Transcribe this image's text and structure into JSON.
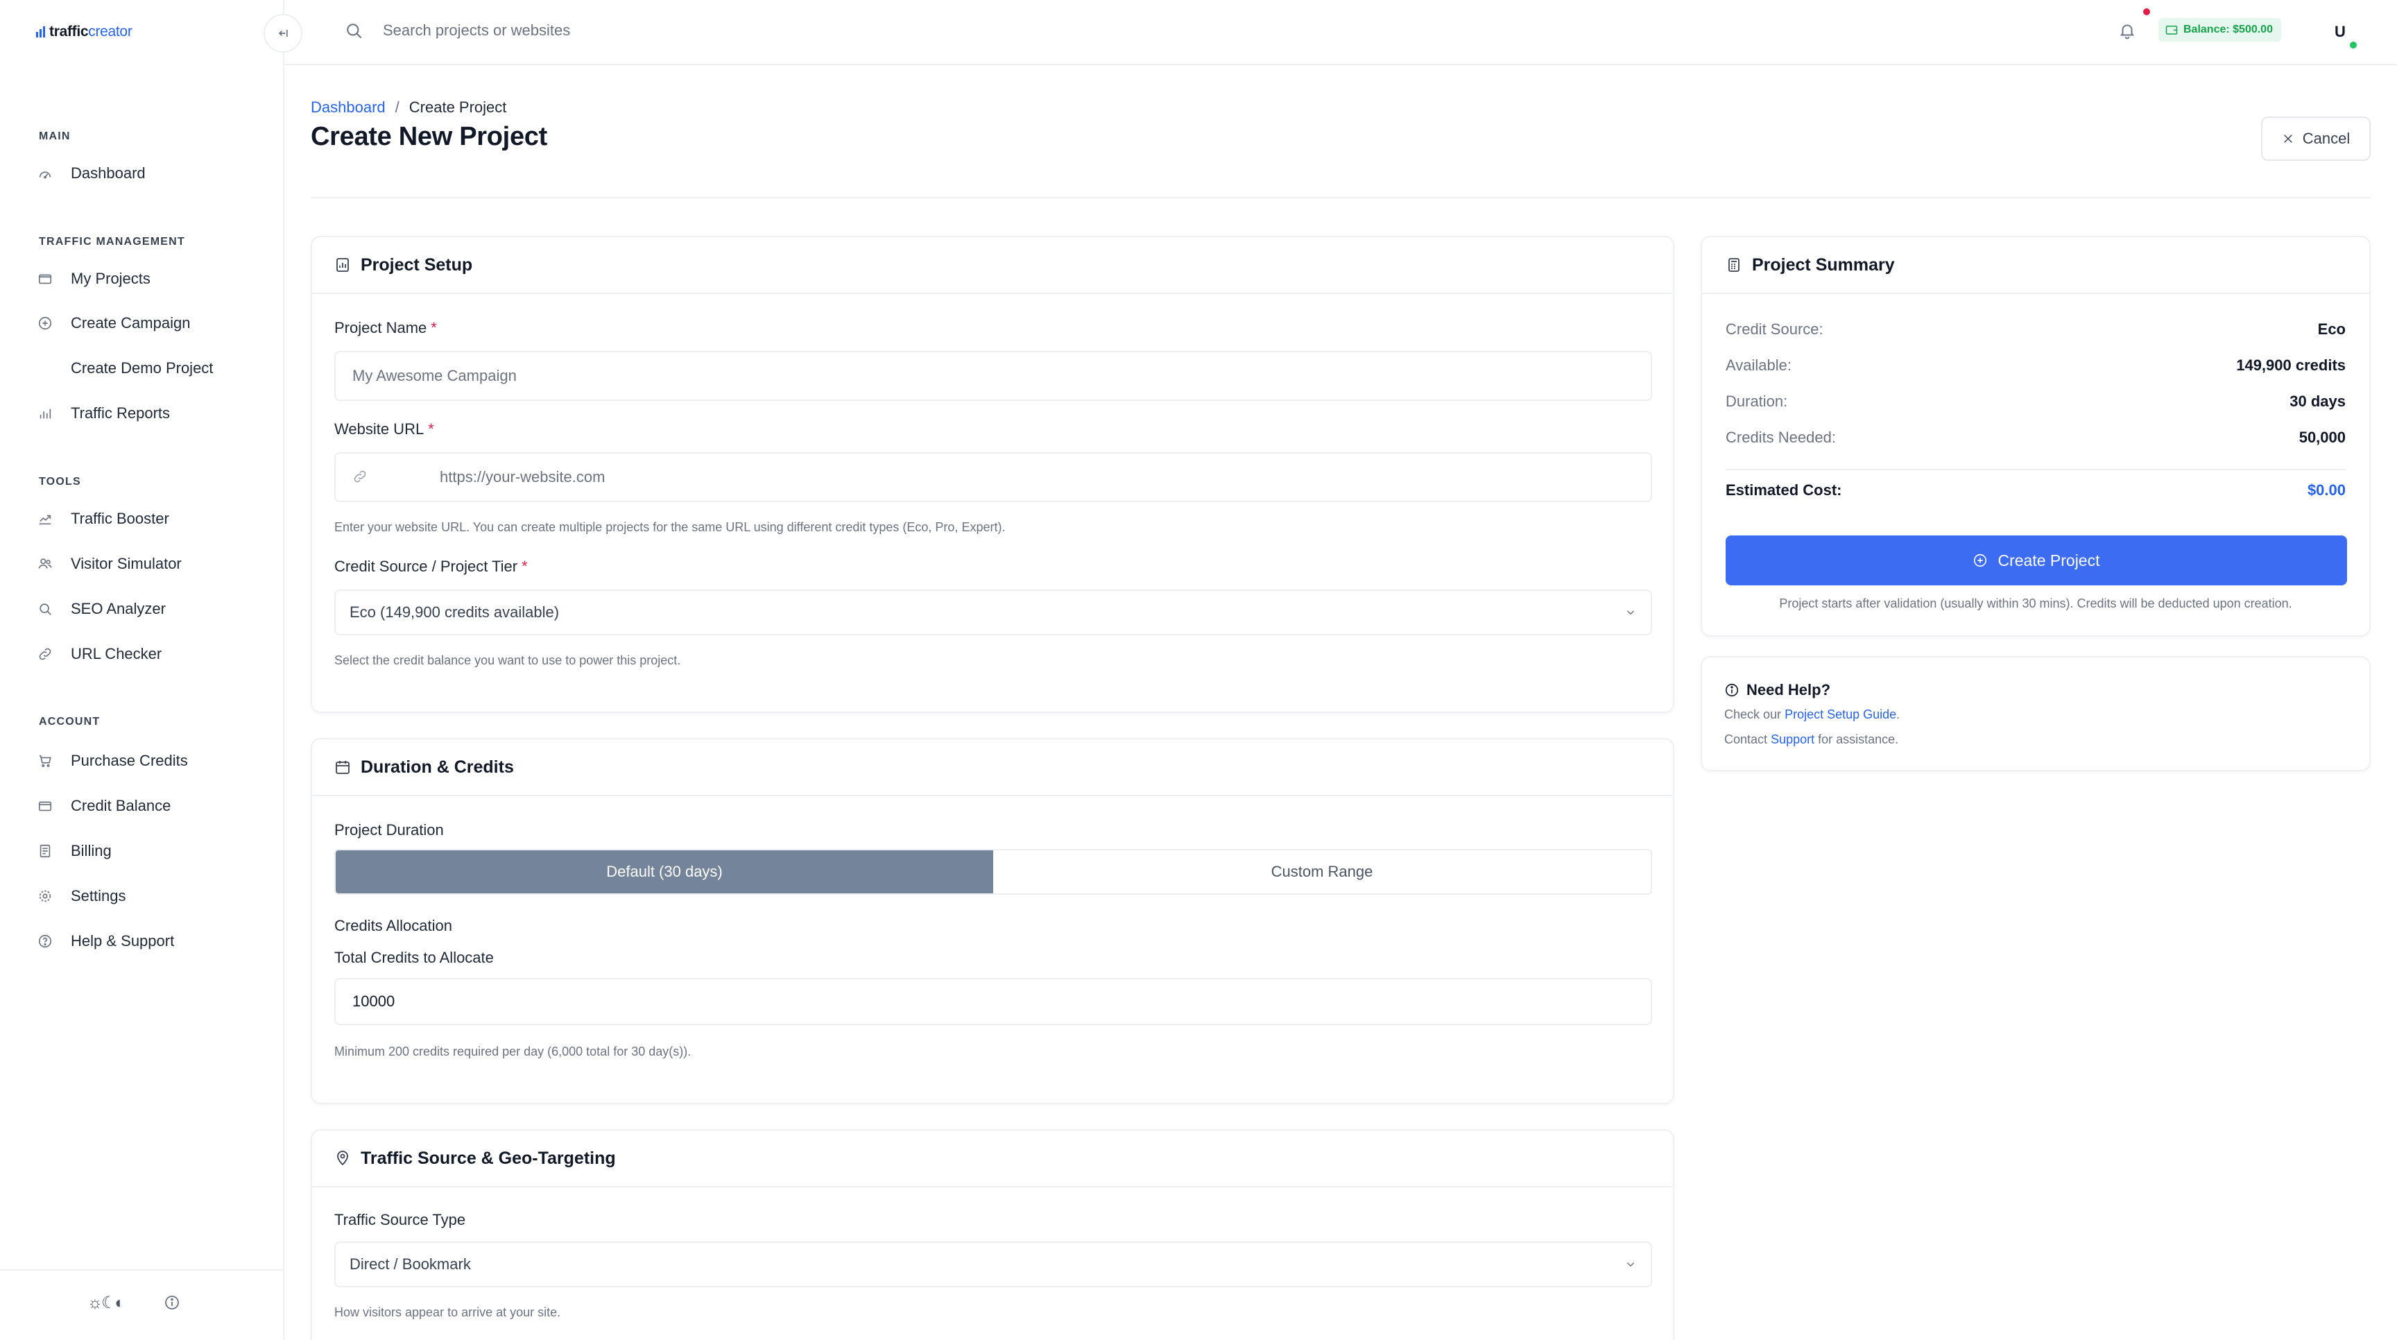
{
  "brand": {
    "part1": "traffic",
    "part2": "creator"
  },
  "topbar": {
    "search_placeholder": "Search projects or websites",
    "balance_label": "Balance: $500.00",
    "avatar_initial": "U"
  },
  "sidebar": {
    "sections": {
      "main": "MAIN",
      "traffic": "TRAFFIC MANAGEMENT",
      "tools": "TOOLS",
      "account": "ACCOUNT"
    },
    "items": {
      "dashboard": "Dashboard",
      "my_projects": "My Projects",
      "create_campaign": "Create Campaign",
      "create_demo": "Create Demo Project",
      "traffic_reports": "Traffic Reports",
      "traffic_booster": "Traffic Booster",
      "visitor_simulator": "Visitor Simulator",
      "seo_analyzer": "SEO Analyzer",
      "url_checker": "URL Checker",
      "purchase_credits": "Purchase Credits",
      "credit_balance": "Credit Balance",
      "billing": "Billing",
      "settings": "Settings",
      "help_support": "Help & Support"
    },
    "theme_toggle": "☼☾◐"
  },
  "page": {
    "breadcrumb": {
      "root": "Dashboard",
      "separator": "/",
      "current": "Create Project"
    },
    "title": "Create New Project",
    "cancel_label": "Cancel"
  },
  "setup": {
    "title": "Project Setup",
    "name_label": "Project Name",
    "required_mark": "*",
    "name_placeholder": "My Awesome Campaign",
    "url_label": "Website URL",
    "url_placeholder": "https://your-website.com",
    "url_hint": "Enter your website URL. You can create multiple projects for the same URL using different credit types (Eco, Pro, Expert).",
    "tier_label": "Credit Source / Project Tier",
    "tier_value": "Eco (149,900 credits available)",
    "tier_hint": "Select the credit balance you want to use to power this project."
  },
  "duration": {
    "title": "Duration & Credits",
    "duration_label": "Project Duration",
    "options": [
      "Default (30 days)",
      "Custom Range"
    ],
    "selected_option": "Default (30 days)",
    "allocation_label": "Credits Allocation",
    "total_label": "Total Credits to Allocate",
    "total_value": "10000",
    "total_hint": "Minimum 200 credits required per day (6,000 total for 30 day(s))."
  },
  "traffic": {
    "title": "Traffic Source & Geo-Targeting",
    "source_label": "Traffic Source Type",
    "source_value": "Direct / Bookmark",
    "source_hint": "How visitors appear to arrive at your site."
  },
  "summary": {
    "title": "Project Summary",
    "rows": [
      {
        "key": "Credit Source:",
        "value": "Eco"
      },
      {
        "key": "Available:",
        "value": "149,900 credits"
      },
      {
        "key": "Duration:",
        "value": "30 days"
      },
      {
        "key": "Credits Needed:",
        "value": "50,000"
      }
    ],
    "estimated_key": "Estimated Cost:",
    "estimated_value": "$0.00",
    "create_label": "Create Project",
    "note": "Project starts after validation (usually within 30 mins). Credits will be deducted upon creation."
  },
  "help": {
    "title": "Need Help?",
    "line1_prefix": "Check our",
    "line1_link": "Project Setup Guide",
    "line1_suffix": ".",
    "line2_prefix": "Contact",
    "line2_link": "Support",
    "line2_suffix": "for assistance."
  },
  "colors": {
    "accent": "#3b6cf2",
    "link": "#2563eb",
    "segment_active": "#74849a",
    "balance_text": "#16a34a",
    "required": "#e11d48"
  }
}
